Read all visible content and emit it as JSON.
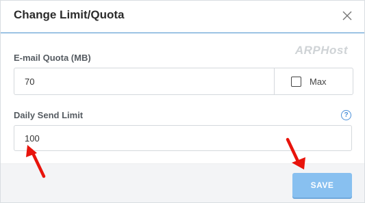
{
  "dialog": {
    "title": "Change Limit/Quota",
    "close_icon": "close-icon",
    "watermark": "ARPHost"
  },
  "quota": {
    "label": "E-mail Quota (MB)",
    "value": "70",
    "max_label": "Max",
    "max_checked": false
  },
  "send_limit": {
    "label": "Daily Send Limit",
    "value": "100",
    "help_icon": "help-icon",
    "help_glyph": "?"
  },
  "footer": {
    "save_label": "SAVE"
  },
  "colors": {
    "accent": "#88c0f0",
    "header_underline": "#9cc3e4",
    "annotation_arrow": "#e8140c",
    "footer_bg": "#f3f4f6"
  }
}
